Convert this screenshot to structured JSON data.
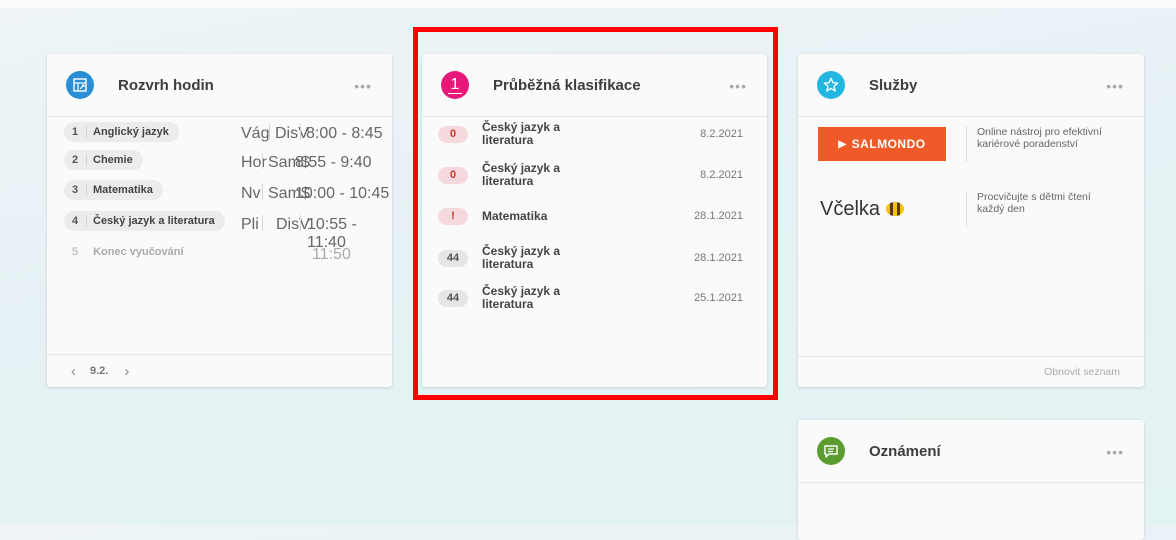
{
  "schedule": {
    "title": "Rozvrh hodin",
    "more": "•••",
    "lessons": [
      {
        "num": "1",
        "name": "Anglický jazyk",
        "teacher": "Vág",
        "room": "DisV",
        "time": "8:00 - 8:45"
      },
      {
        "num": "2",
        "name": "Chemie",
        "teacher": "Hor",
        "room": "Sam$",
        "time": "8:55 - 9:40"
      },
      {
        "num": "3",
        "name": "Matematika",
        "teacher": "Nv",
        "room": "Sam$",
        "time": "10:00 - 10:45"
      },
      {
        "num": "4",
        "name": "Český jazyk a literatura",
        "teacher": "Pli",
        "room": "DisV",
        "time": "10:55 - 11:40"
      }
    ],
    "end": {
      "num": "5",
      "label": "Konec vyučování",
      "time": "11:50"
    },
    "date": "9.2.",
    "prev_icon": "chevron-left-icon",
    "next_icon": "chevron-right-icon"
  },
  "grades": {
    "title": "Průběžná klasifikace",
    "more": "•••",
    "icon_label": "1",
    "items": [
      {
        "badge": "0",
        "subject_line1": "Český jazyk a",
        "subject_line2": "literatura",
        "date": "8.2.2021"
      },
      {
        "badge": "0",
        "subject_line1": "Český jazyk a",
        "subject_line2": "literatura",
        "date": "8.2.2021"
      },
      {
        "badge": "!",
        "subject_line1": "Matematika",
        "subject_line2": "",
        "date": "28.1.2021"
      },
      {
        "badge": "44",
        "subject_line1": "Český jazyk a",
        "subject_line2": "literatura",
        "date": "28.1.2021"
      },
      {
        "badge": "44",
        "subject_line1": "Český jazyk a",
        "subject_line2": "literatura",
        "date": "25.1.2021"
      }
    ]
  },
  "services": {
    "title": "Služby",
    "more": "•••",
    "items": [
      {
        "logo": "SALMONDO",
        "desc_line1": "Online nástroj pro efektivní",
        "desc_line2": "kariérové poradenství"
      },
      {
        "logo": "Včelka",
        "desc_line1": "Procvičujte s dětmi čtení",
        "desc_line2": "každý den"
      }
    ],
    "refresh": "Obnovit seznam"
  },
  "announcements": {
    "title": "Oznámení",
    "more": "•••"
  },
  "colors": {
    "schedule_icon": "#2a8fd6",
    "grades_icon": "#e6197a",
    "services_icon": "#23b6e0",
    "announce_icon": "#5b9e2f",
    "highlight": "#ff0000",
    "salmondo": "#f05a28"
  }
}
